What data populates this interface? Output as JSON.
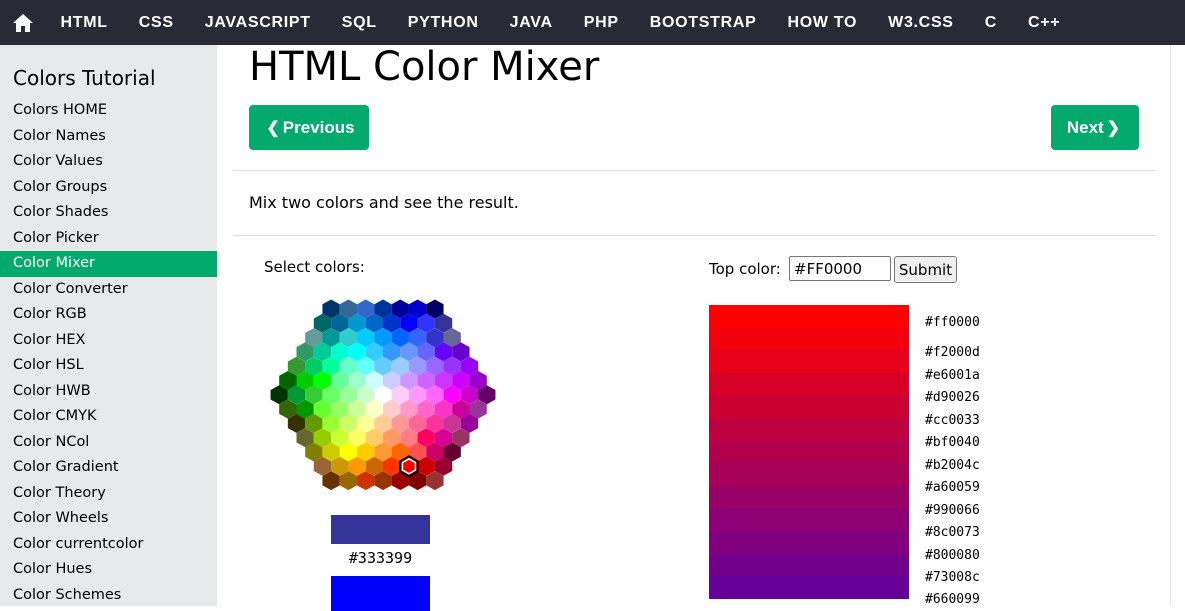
{
  "nav": {
    "home_icon": "home-icon",
    "items": [
      "HTML",
      "CSS",
      "JAVASCRIPT",
      "SQL",
      "PYTHON",
      "JAVA",
      "PHP",
      "BOOTSTRAP",
      "HOW TO",
      "W3.CSS",
      "C",
      "C++"
    ]
  },
  "sidebar": {
    "title": "Colors Tutorial",
    "items": [
      "Colors HOME",
      "Color Names",
      "Color Values",
      "Color Groups",
      "Color Shades",
      "Color Picker",
      "Color Mixer",
      "Color Converter",
      "Color RGB",
      "Color HEX",
      "Color HSL",
      "Color HWB",
      "Color CMYK",
      "Color NCol",
      "Color Gradient",
      "Color Theory",
      "Color Wheels",
      "Color currentcolor",
      "Color Hues",
      "Color Schemes"
    ],
    "active_item": "Color Mixer"
  },
  "main": {
    "title": "HTML Color Mixer",
    "prev_label": "Previous",
    "next_label": "Next",
    "intro": "Mix two colors and see the result.",
    "select_label": "Select colors:",
    "selected_color_1": "#333399",
    "selected_color_2": "#0000ff",
    "top_color_label": "Top color:",
    "top_color_value": "#FF0000",
    "submit_label": "Submit"
  },
  "mix_codes": [
    "#ff0000",
    "#f2000d",
    "#e6001a",
    "#d90026",
    "#cc0033",
    "#bf0040",
    "#b2004c",
    "#a60059",
    "#990066",
    "#8c0073",
    "#800080",
    "#73008c",
    "#660099"
  ],
  "colors": {
    "accent": "#04aa6d",
    "nav_bg": "#282a35",
    "sidebar_bg": "#e7e9eb"
  },
  "hex_palette": [
    [
      "#003366",
      "#336699",
      "#3366CC",
      "#003399",
      "#000099",
      "#0000CC",
      "#000066"
    ],
    [
      "#006666",
      "#006699",
      "#0099CC",
      "#0066CC",
      "#0033CC",
      "#0000FF",
      "#3333FF",
      "#333399"
    ],
    [
      "#669999",
      "#009999",
      "#33CCCC",
      "#00CCFF",
      "#0099FF",
      "#0066FF",
      "#3366FF",
      "#3333CC",
      "#666699"
    ],
    [
      "#339966",
      "#00CC99",
      "#00FFCC",
      "#00FFFF",
      "#33CCFF",
      "#3399FF",
      "#6699FF",
      "#6666FF",
      "#6600FF",
      "#6600CC"
    ],
    [
      "#339933",
      "#00CC66",
      "#00FF99",
      "#66FFCC",
      "#66FFFF",
      "#66CCFF",
      "#99CCFF",
      "#9999FF",
      "#9966FF",
      "#9933FF",
      "#9900FF"
    ],
    [
      "#006600",
      "#00CC00",
      "#00FF00",
      "#66FF99",
      "#99FFCC",
      "#CCFFFF",
      "#CCCCFF",
      "#CC99FF",
      "#CC66FF",
      "#CC33FF",
      "#CC00FF",
      "#9900CC"
    ],
    [
      "#003300",
      "#009933",
      "#33CC33",
      "#66FF66",
      "#99FF99",
      "#CCFFCC",
      "#FFFFFF",
      "#FFCCFF",
      "#FF99FF",
      "#FF66FF",
      "#FF00FF",
      "#CC00CC",
      "#660066"
    ],
    [
      "#336600",
      "#009900",
      "#66FF33",
      "#99FF66",
      "#CCFF99",
      "#FFFFCC",
      "#FFCCCC",
      "#FF99CC",
      "#FF66CC",
      "#FF33CC",
      "#CC0099",
      "#993399"
    ],
    [
      "#333300",
      "#669900",
      "#99FF33",
      "#CCFF66",
      "#FFFF99",
      "#FFCC99",
      "#FF9999",
      "#FF6699",
      "#FF3399",
      "#CC3399",
      "#990099"
    ],
    [
      "#666633",
      "#99CC00",
      "#CCFF33",
      "#FFFF66",
      "#FFCC66",
      "#FF9966",
      "#FF7C80",
      "#FF0066",
      "#D60093",
      "#993366"
    ],
    [
      "#808000",
      "#CCCC00",
      "#FFFF00",
      "#FFCC00",
      "#FF9933",
      "#FF6600",
      "#FF5050",
      "#CC0066",
      "#660033"
    ],
    [
      "#996633",
      "#CC9900",
      "#FF9900",
      "#CC6600",
      "#FF3300",
      "#FF0000",
      "#CC0000",
      "#990033"
    ],
    [
      "#663300",
      "#996600",
      "#CC3300",
      "#993300",
      "#990000",
      "#800000",
      "#993333"
    ]
  ],
  "selected_hex": "#FF0000"
}
